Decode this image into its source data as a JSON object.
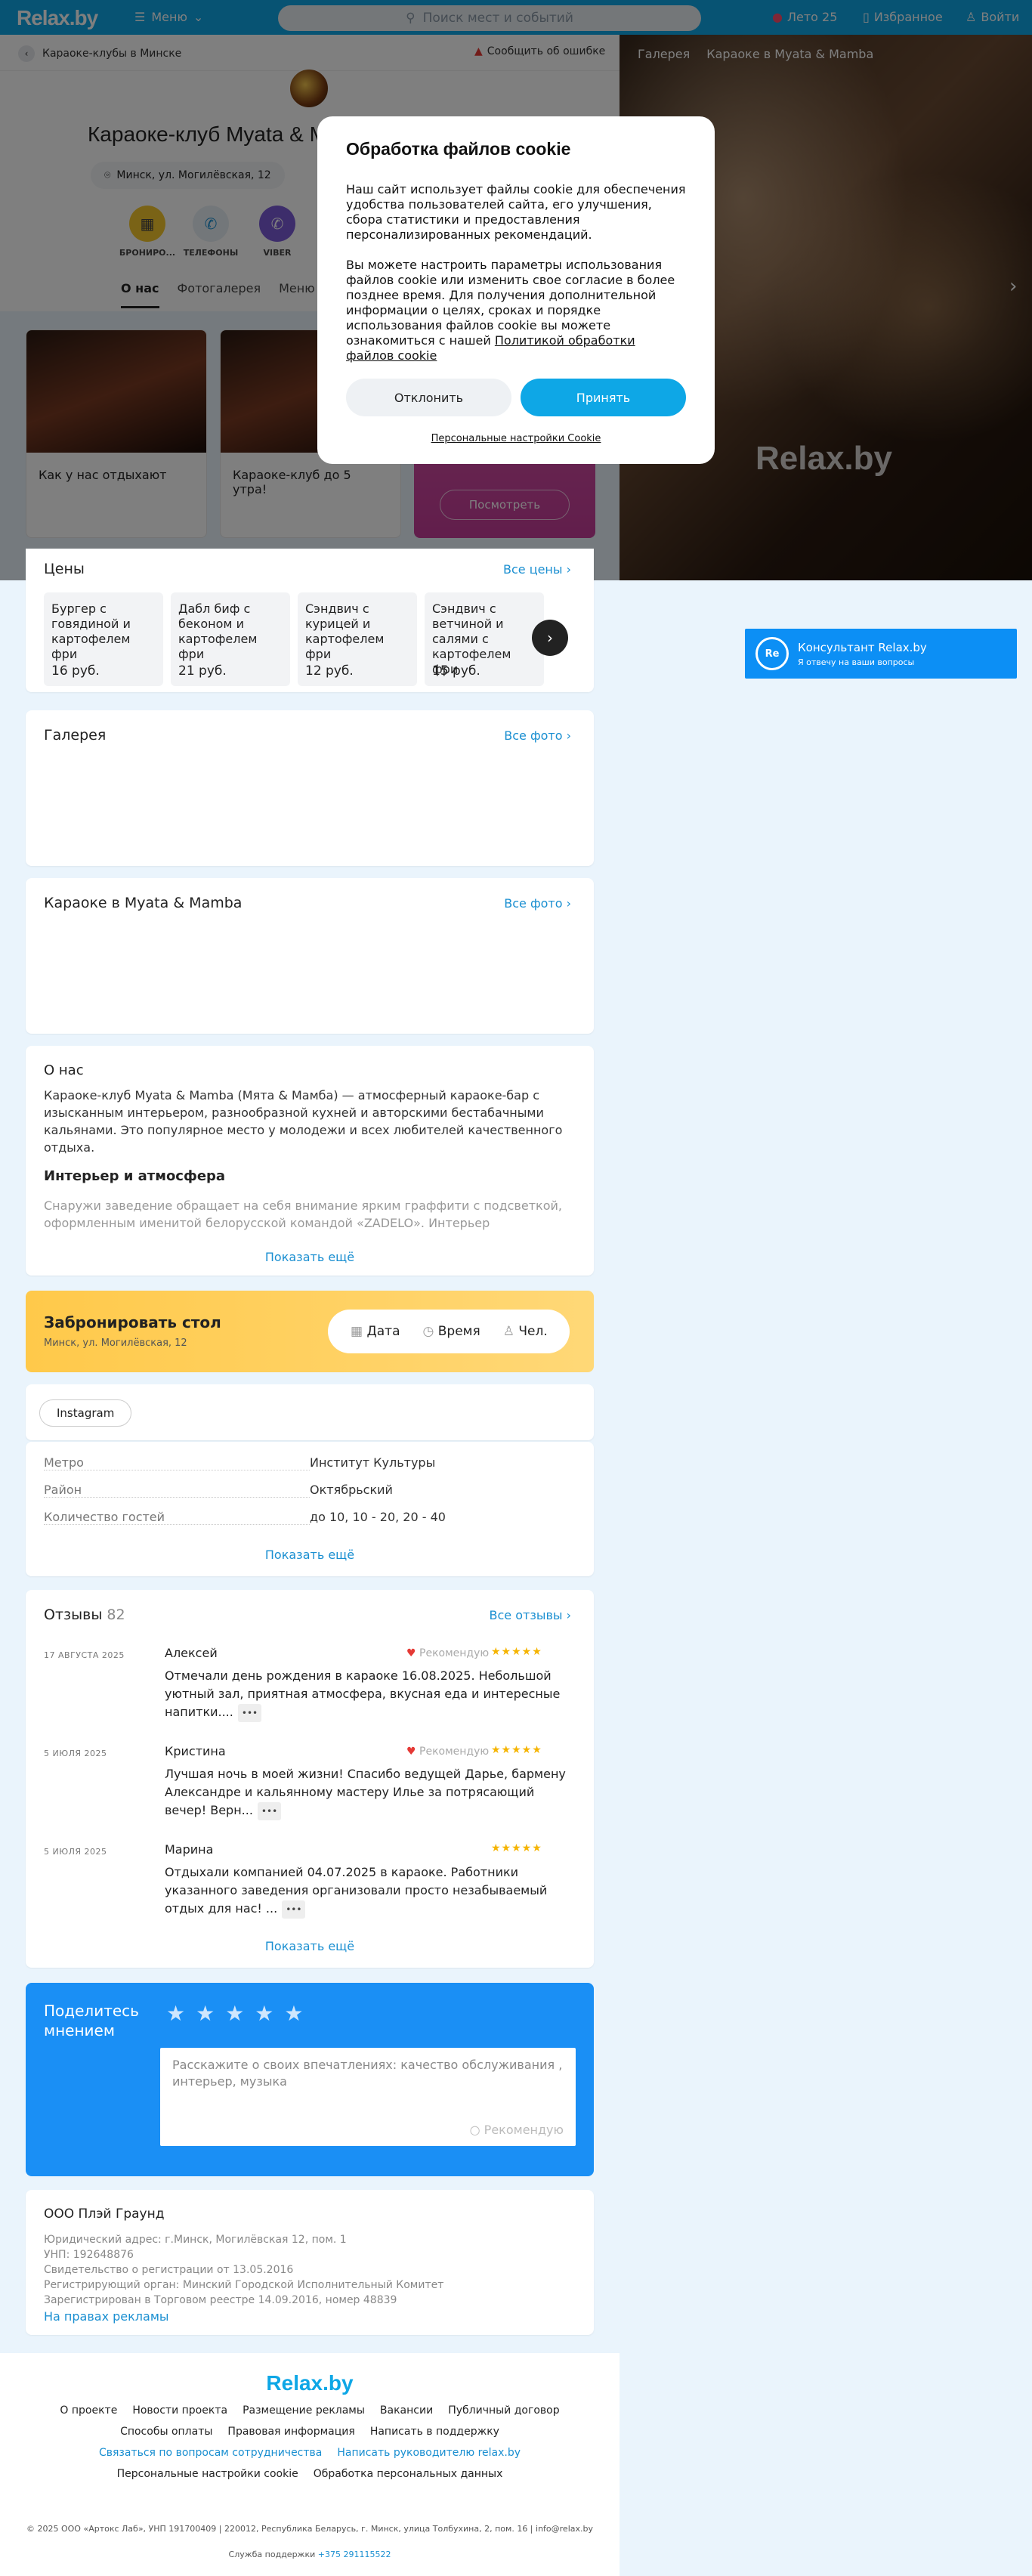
{
  "header": {
    "logo": "Relax.by",
    "menu_label": "Меню",
    "search_placeholder": "Поиск мест и событий",
    "summer_label": "Лето 25",
    "favorites_label": "Избранное",
    "login_label": "Войти"
  },
  "topbar": {
    "breadcrumb": "Караоке-клубы в Минске",
    "report_error": "Сообщить об ошибке"
  },
  "venue": {
    "title": "Караоке-клуб Myata & M",
    "address": "Минск, ул. Могилёвская, 12",
    "actions": [
      "БРОНИРО...",
      "ТЕЛЕФОНЫ",
      "VIBER"
    ],
    "tabs": [
      "О нас",
      "Фотогалерея",
      "Меню и"
    ]
  },
  "gallery_right": {
    "tabs": [
      "Галерея",
      "Караоке в Myata & Mamba"
    ],
    "watermark": "Relax.by"
  },
  "cards": [
    {
      "caption": "Как у нас отдыхают"
    },
    {
      "caption": "Караоке-клуб до 5 утра!"
    }
  ],
  "promo": {
    "button": "Посмотреть"
  },
  "cookie": {
    "title": "Обработка файлов cookie",
    "p1": "Наш сайт использует файлы cookie для обеспечения удобства пользователей сайта, его улучшения, сбора статистики и предоставления персонализированных рекомендаций.",
    "p2": "Вы можете настроить параметры использования файлов cookie или изменить свое согласие в более позднее время. Для получения дополнительной информации о целях, сроках и порядке использования файлов cookie вы можете ознакомиться с нашей",
    "policy_link": "Политикой обработки файлов cookie",
    "decline": "Отклонить",
    "accept": "Принять",
    "settings": "Персональные настройки Cookie"
  },
  "prices": {
    "title": "Цены",
    "all": "Все цены",
    "items": [
      {
        "name": "Бургер с говядиной и картофелем фри",
        "price": "16 руб."
      },
      {
        "name": "Дабл биф с беконом и картофелем фри",
        "price": "21 руб."
      },
      {
        "name": "Сэндвич с курицей и картофелем фри",
        "price": "12 руб."
      },
      {
        "name": "Сэндвич с ветчиной и салями с картофелем фри",
        "price": "15 руб."
      }
    ]
  },
  "consultant": {
    "title": "Консультант Relax.by",
    "subtitle": "Я отвечу на ваши вопросы",
    "badge": "Re"
  },
  "gallery": {
    "title": "Галерея",
    "all": "Все фото"
  },
  "karaoke": {
    "title": "Караоке в Myata & Mamba",
    "all": "Все фото"
  },
  "about": {
    "title": "О нас",
    "text": "Караоке-клуб Myata & Mamba (Мята & Мамба) — атмосферный караоке-бар с изысканным интерьером, разнообразной кухней и авторскими бестабачными кальянами. Это популярное место у молодежи и всех любителей качественного отдыха.",
    "subtitle": "Интерьер и атмосфера",
    "text2": "Снаружи заведение обращает на себя внимание ярким граффити с подсветкой, оформленным именитой белорусской командой «ZADELO». Интерьер представлен в",
    "more": "Показать ещё"
  },
  "booking": {
    "title": "Забронировать стол",
    "address": "Минск, ул. Могилёвская, 12",
    "date": "Дата",
    "time": "Время",
    "people": "Чел."
  },
  "social": {
    "instagram": "Instagram"
  },
  "info": {
    "rows": [
      {
        "k": "Метро",
        "v": "Институт Культуры"
      },
      {
        "k": "Район",
        "v": "Октябрьский"
      },
      {
        "k": "Количество гостей",
        "v": "до 10, 10 - 20, 20 - 40"
      }
    ],
    "more": "Показать ещё"
  },
  "reviews": {
    "title": "Отзывы",
    "count": "82",
    "all": "Все отзывы",
    "recommend": "Рекомендую",
    "items": [
      {
        "date": "17 АВГУСТА 2025",
        "name": "Алексей",
        "text": "Отмечали день рождения в караоке 16.08.2025. Небольшой уютный зал, приятная атмосфера, вкусная еда и интересные напитки....",
        "rating": 5
      },
      {
        "date": "5 ИЮЛЯ 2025",
        "name": "Кристина",
        "text": "Лучшая ночь в моей жизни! Спасибо ведущей Дарье, бармену Александре и кальянному мастеру Илье за потрясающий вечер! Верн...",
        "rating": 5
      },
      {
        "date": "5 ИЮЛЯ 2025",
        "name": "Марина",
        "text": "Отдыхали компанией 04.07.2025 в караоке. Работники указанного заведения организовали просто незабываемый отдых для нас! ...",
        "rating": 5
      }
    ],
    "more": "Показать ещё"
  },
  "share": {
    "title": "Поделитесь мнением",
    "placeholder": "Расскажите о своих впечатлениях: качество обслуживания , интерьер, музыка",
    "recommend": "Рекомендую"
  },
  "company": {
    "title": "ООО Плэй Граунд",
    "lines": [
      "Юридический адрес: г.Минск, Могилёвская 12, пом. 1",
      "УНП: 192648876",
      "Свидетельство о регистрации от 13.05.2016",
      "Регистрирующий орган: Минский Городской Исполнительный Комитет",
      "Зарегистрирован в Торговом реестре 14.09.2016, номер 48839"
    ],
    "ad": "На правах рекламы"
  },
  "footer": {
    "logo": "Relax.by",
    "row1": [
      "О проекте",
      "Новости проекта",
      "Размещение рекламы",
      "Вакансии",
      "Публичный договор"
    ],
    "row2": [
      "Способы оплаты",
      "Правовая информация",
      "Написать в поддержку"
    ],
    "row3": [
      "Связаться по вопросам сотрудничества",
      "Написать руководителю relax.by"
    ],
    "row4": [
      "Персональные настройки cookie",
      "Обработка персональных данных"
    ],
    "copyright": "© 2025 ООО «Артокс Лаб», УНП 191700409 | 220012, Республика Беларусь, г. Минск, улица Толбухина, 2, пом. 16 | info@relax.by",
    "support_label": "Служба поддержки",
    "support_phone": "+375 291115522"
  },
  "colors": {
    "accent": "#0ea7e6",
    "link": "#1a8fd1",
    "share_bg": "#1a8ff5",
    "booking_bg": "#ffc94a",
    "promo_bg": "#c43c98"
  }
}
